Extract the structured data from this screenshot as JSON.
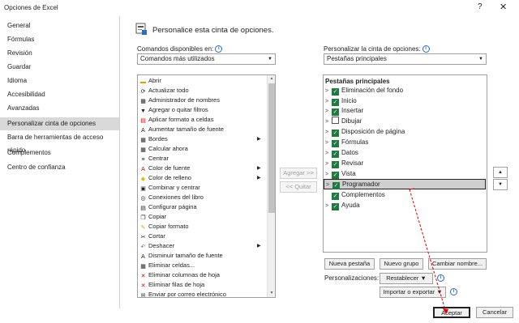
{
  "window": {
    "title": "Opciones de Excel",
    "help": "?",
    "close": "✕"
  },
  "nav": [
    "General",
    "Fórmulas",
    "Revisión",
    "Guardar",
    "Idioma",
    "Accesibilidad",
    "Avanzadas",
    "Personalizar cinta de opciones",
    "Barra de herramientas de acceso rápido",
    "Complementos",
    "Centro de confianza"
  ],
  "nav_active": "Personalizar cinta de opciones",
  "header": {
    "text": "Personalice esta cinta de opciones."
  },
  "left": {
    "label": "Comandos disponibles en:",
    "combo_value": "Comandos más utilizados",
    "commands": [
      "Abrir",
      "Actualizar todo",
      "Administrador de nombres",
      "Agregar o quitar filtros",
      "Aplicar formato a celdas",
      "Aumentar tamaño de fuente",
      "Bordes",
      "Calcular ahora",
      "Centrar",
      "Color de fuente",
      "Color de relleno",
      "Combinar y centrar",
      "Conexiones del libro",
      "Configurar página",
      "Copiar",
      "Copiar formato",
      "Cortar",
      "Deshacer",
      "Disminuir tamaño de fuente",
      "Eliminar celdas...",
      "Eliminar columnas de hoja",
      "Eliminar filas de hoja",
      "Enviar por correo electrónico"
    ]
  },
  "middle": {
    "add": "Agregar >>",
    "remove": "<< Quitar"
  },
  "right": {
    "label": "Personalizar la cinta de opciones:",
    "combo_value": "Pestañas principales",
    "tree_header": "Pestañas principales",
    "tabs": [
      {
        "label": "Eliminación del fondo",
        "checked": true
      },
      {
        "label": "Inicio",
        "checked": true
      },
      {
        "label": "Insertar",
        "checked": true
      },
      {
        "label": "Dibujar",
        "checked": false
      },
      {
        "label": "Disposición de página",
        "checked": true
      },
      {
        "label": "Fórmulas",
        "checked": true
      },
      {
        "label": "Datos",
        "checked": true
      },
      {
        "label": "Revisar",
        "checked": true
      },
      {
        "label": "Vista",
        "checked": true
      },
      {
        "label": "Programador",
        "checked": true
      },
      {
        "label": "Complementos",
        "checked": true
      },
      {
        "label": "Ayuda",
        "checked": true
      }
    ],
    "new_tab": "Nueva pestaña",
    "new_group": "Nuevo grupo",
    "rename": "Cambiar nombre...",
    "customizations_label": "Personalizaciones:",
    "reset": "Restablecer",
    "import_export": "Importar o exportar"
  },
  "footer": {
    "ok": "Aceptar",
    "cancel": "Cancelar"
  },
  "colors": {
    "accent": "#1e7b3c",
    "selection": "#cfcfcf",
    "arrow": "#e00000"
  }
}
